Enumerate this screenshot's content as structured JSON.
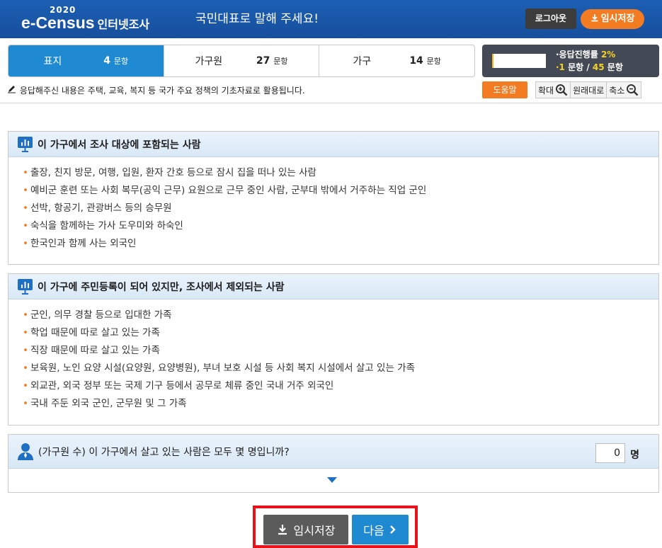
{
  "header": {
    "logo_year": "2020",
    "logo_brand": "e-Census",
    "logo_sub": "인터넷조사",
    "slogan": "국민대표로 말해 주세요!",
    "logout_label": "로그아웃",
    "tempsave_label": "임시저장"
  },
  "tabs": [
    {
      "label": "표지",
      "count": "4",
      "unit": "문항",
      "active": true
    },
    {
      "label": "가구원",
      "count": "27",
      "unit": "문항",
      "active": false
    },
    {
      "label": "가구",
      "count": "14",
      "unit": "문항",
      "active": false
    }
  ],
  "progress": {
    "rate_label": "·응답진행률",
    "rate_value": "2%",
    "rate_fraction": 0.02,
    "current": "·1",
    "count_mid": " 문항 / ",
    "total": "45",
    "count_unit": " 문항"
  },
  "notice": "응답해주신 내용은 주택, 교육, 복지 등 국가 주요 정책의 기초자료로 활용됩니다.",
  "toolbar": {
    "help_label": "도움말",
    "zoom_in_label": "확대",
    "reset_label": "원래대로",
    "zoom_out_label": "축소"
  },
  "section1": {
    "title": "이 가구에서 조사 대상에 포함되는 사람",
    "items": [
      "출장, 친지 방문, 여행, 입원, 환자 간호 등으로 잠시 집을 떠나 있는 사람",
      "예비군 훈련 또는 사회 복무(공익 근무) 요원으로 근무 중인 사람, 군부대 밖에서 거주하는 직업 군인",
      "선박, 항공기, 관광버스 등의 승무원",
      "숙식을 함께하는 가사 도우미와 하숙인",
      "한국인과 함께 사는 외국인"
    ]
  },
  "section2": {
    "title": "이 가구에 주민등록이 되어 있지만, 조사에서 제외되는 사람",
    "items": [
      "군인, 의무 경찰 등으로 입대한 가족",
      "학업 때문에 따로 살고 있는 가족",
      "직장 때문에 따로 살고 있는 가족",
      "보육원, 노인 요양 시설(요양원, 요양병원), 부녀 보호 시설 등 사회 복지 시설에서 살고 있는 가족",
      "외교관, 외국 정부 또는 국제 기구 등에서 공무로 체류 중인 국내 거주 외국인",
      "국내 주둔 외국 군인, 군무원 및 그 가족"
    ]
  },
  "question": {
    "text": "(가구원 수) 이 가구에서 살고 있는 사람은 모두 몇 명입니까?",
    "value": "0",
    "unit": "명"
  },
  "footer": {
    "save_label": "임시저장",
    "next_label": "다음"
  },
  "colors": {
    "header_blue": "#1c5fb4",
    "accent_orange": "#f37c22",
    "active_tab": "#1f8ad2",
    "highlight_red": "#e8121b"
  }
}
